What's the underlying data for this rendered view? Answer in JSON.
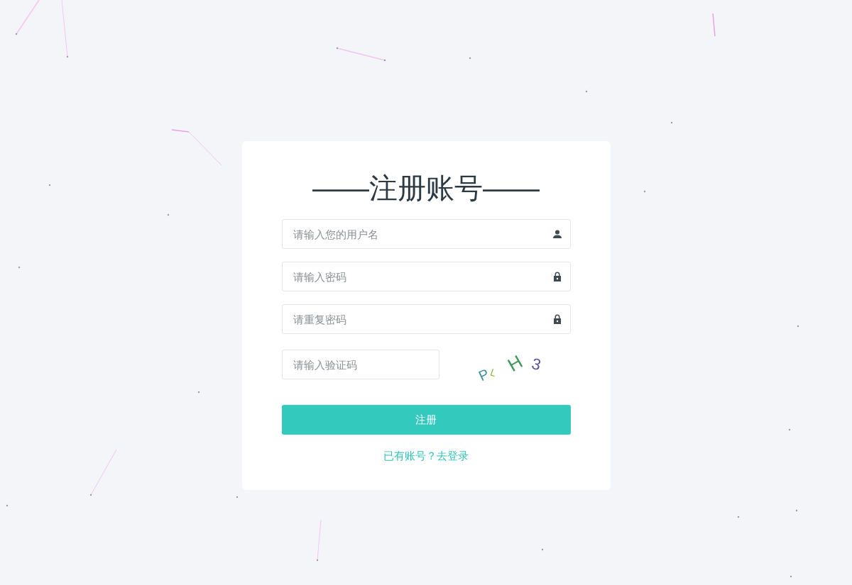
{
  "title": "——注册账号——",
  "fields": [
    {
      "placeholder": "请输入您的用户名",
      "kind": "user"
    },
    {
      "placeholder": "请输入密码",
      "kind": "lock"
    },
    {
      "placeholder": "请重复密码",
      "kind": "lock"
    }
  ],
  "captcha": {
    "placeholder": "请输入验证码",
    "chars": [
      {
        "char": "P",
        "color": "#3a8fa0"
      },
      {
        "char": "L",
        "color": "#8cbf3a"
      },
      {
        "char": "H",
        "color": "#3f9a5a"
      },
      {
        "char": "3",
        "color": "#5a4d9a"
      }
    ]
  },
  "submit": "注册",
  "login_link": "已有账号？去登录"
}
